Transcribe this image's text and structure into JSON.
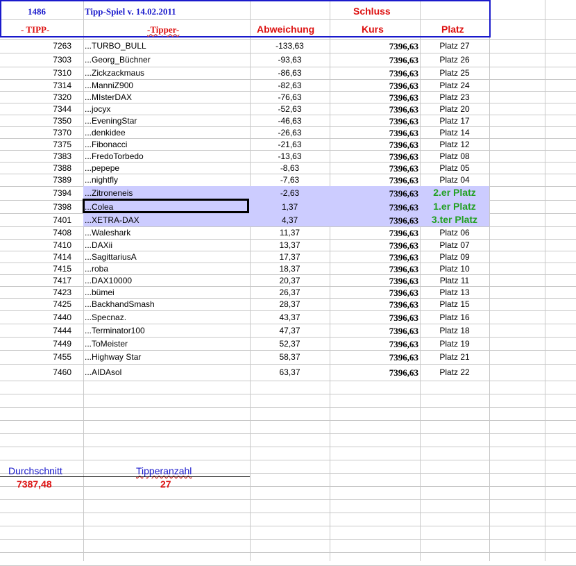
{
  "header": {
    "tipp_count": "1486",
    "title": "Tipp-Spiel v. 14.02.2011",
    "schluss": "Schluss",
    "col_tipp": "- TIPP-",
    "col_tipper": "-Tipper-",
    "col_abweichung": "Abweichung",
    "col_kurs": "Kurs",
    "col_platz": "Platz"
  },
  "rows": [
    {
      "tipp": "7263",
      "name": "...TURBO_BULL",
      "abw": "-133,63",
      "kurs": "7396,63",
      "platz": "Platz 27"
    },
    {
      "tipp": "7303",
      "name": "...Georg_Büchner",
      "abw": "-93,63",
      "kurs": "7396,63",
      "platz": "Platz 26"
    },
    {
      "tipp": "7310",
      "name": "...Zickzackmaus",
      "abw": "-86,63",
      "kurs": "7396,63",
      "platz": "Platz 25"
    },
    {
      "tipp": "7314",
      "name": "...ManniZ900",
      "abw": "-82,63",
      "kurs": "7396,63",
      "platz": "Platz 24"
    },
    {
      "tipp": "7320",
      "name": "...MIsterDAX",
      "abw": "-76,63",
      "kurs": "7396,63",
      "platz": "Platz 23"
    },
    {
      "tipp": "7344",
      "name": "...jocyx",
      "abw": "-52,63",
      "kurs": "7396,63",
      "platz": "Platz 20"
    },
    {
      "tipp": "7350",
      "name": "...EveningStar",
      "abw": "-46,63",
      "kurs": "7396,63",
      "platz": "Platz 17"
    },
    {
      "tipp": "7370",
      "name": "...denkidee",
      "abw": "-26,63",
      "kurs": "7396,63",
      "platz": "Platz 14"
    },
    {
      "tipp": "7375",
      "name": "...Fibonacci",
      "abw": "-21,63",
      "kurs": "7396,63",
      "platz": "Platz 12"
    },
    {
      "tipp": "7383",
      "name": "...FredoTorbedo",
      "abw": "-13,63",
      "kurs": "7396,63",
      "platz": "Platz 08"
    },
    {
      "tipp": "7388",
      "name": "...pepepe",
      "abw": "-8,63",
      "kurs": "7396,63",
      "platz": "Platz 05"
    },
    {
      "tipp": "7389",
      "name": "...nightfly",
      "abw": "-7,63",
      "kurs": "7396,63",
      "platz": "Platz 04"
    },
    {
      "tipp": "7394",
      "name": "...Zitroneneis",
      "abw": "-2,63",
      "kurs": "7396,63",
      "platz": "2.er Platz",
      "winner": true
    },
    {
      "tipp": "7398",
      "name": "...Colea",
      "abw": "1,37",
      "kurs": "7396,63",
      "platz": "1.er Platz",
      "winner": true,
      "selected": true
    },
    {
      "tipp": "7401",
      "name": "...XETRA-DAX",
      "abw": "4,37",
      "kurs": "7396,63",
      "platz": "3.ter Platz",
      "winner": true
    },
    {
      "tipp": "7408",
      "name": "...Waleshark",
      "abw": "11,37",
      "kurs": "7396,63",
      "platz": "Platz 06"
    },
    {
      "tipp": "7410",
      "name": "...DAXii",
      "abw": "13,37",
      "kurs": "7396,63",
      "platz": "Platz 07"
    },
    {
      "tipp": "7414",
      "name": "...SagittariusA",
      "abw": "17,37",
      "kurs": "7396,63",
      "platz": "Platz 09"
    },
    {
      "tipp": "7415",
      "name": "...roba",
      "abw": "18,37",
      "kurs": "7396,63",
      "platz": "Platz 10"
    },
    {
      "tipp": "7417",
      "name": "...DAX10000",
      "abw": "20,37",
      "kurs": "7396,63",
      "platz": "Platz 11"
    },
    {
      "tipp": "7423",
      "name": "...bümei",
      "abw": "26,37",
      "kurs": "7396,63",
      "platz": "Platz 13"
    },
    {
      "tipp": "7425",
      "name": "...BackhandSmash",
      "abw": "28,37",
      "kurs": "7396,63",
      "platz": "Platz 15"
    },
    {
      "tipp": "7440",
      "name": "...Specnaz.",
      "abw": "43,37",
      "kurs": "7396,63",
      "platz": "Platz 16"
    },
    {
      "tipp": "7444",
      "name": "...Terminator100",
      "abw": "47,37",
      "kurs": "7396,63",
      "platz": "Platz 18"
    },
    {
      "tipp": "7449",
      "name": "...ToMeister",
      "abw": "52,37",
      "kurs": "7396,63",
      "platz": "Platz 19"
    },
    {
      "tipp": "7455",
      "name": "...Highway Star",
      "abw": "58,37",
      "kurs": "7396,63",
      "platz": "Platz 21"
    },
    {
      "tipp": "7460",
      "name": "...AIDAsol",
      "abw": "63,37",
      "kurs": "7396,63",
      "platz": "Platz 22"
    }
  ],
  "summary": {
    "avg_label": "Durchschnitt",
    "avg_value": "7387,48",
    "count_label": "Tipperanzahl",
    "count_value": "27"
  }
}
